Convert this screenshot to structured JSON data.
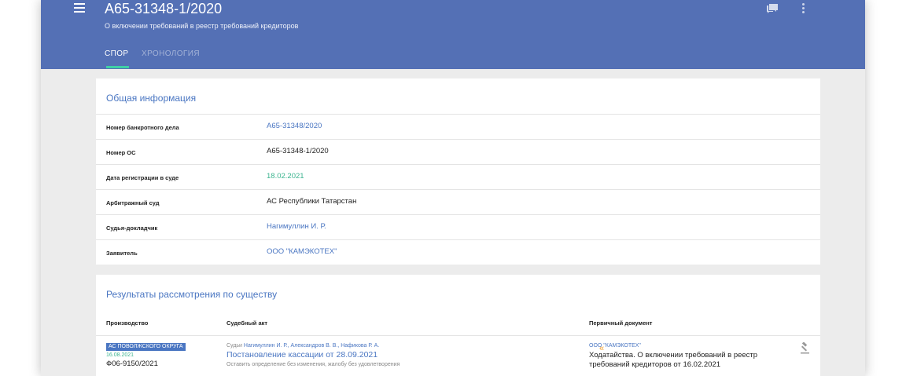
{
  "header": {
    "title": "А65-31348-1/2020",
    "subtitle": "О включении требований в реестр требований кредиторов",
    "tabs": [
      {
        "label": "СПОР",
        "active": true
      },
      {
        "label": "ХРОНОЛОГИЯ",
        "active": false
      }
    ],
    "icons": {
      "menu": "menu-icon",
      "chat": "chat-icon",
      "more": "more-vert-icon"
    }
  },
  "general": {
    "title": "Общая информация",
    "rows": [
      {
        "label": "Номер банкротного дела",
        "value": "А65-31348/2020"
      },
      {
        "label": "Номер ОС",
        "value": "А65-31348-1/2020"
      },
      {
        "label": "Дата регистрации в суде",
        "value": "18.02.2021"
      },
      {
        "label": "Арбитражный суд",
        "value": "АС Республики Татарстан"
      },
      {
        "label": "Судья-докладчик",
        "value": "Нагимуллин И. Р."
      },
      {
        "label": "Заявитель",
        "value": "ООО \"КАМЭКОТЕХ\""
      }
    ]
  },
  "results": {
    "title": "Результаты рассмотрения по существу",
    "columns": [
      "Производство",
      "Судебный акт",
      "Первичный документ"
    ],
    "row": {
      "court_badge": "АС ПОВОЛЖСКОГО ОКРУГА",
      "date": "16.08.2021",
      "case_number": "Ф06-9150/2021",
      "judges_prefix": "Судьи",
      "judges": "Нагимуллин И. Р., Александров В. В., Нафикова Р. А.",
      "act_title": "Постановление кассации от 28.09.2021",
      "act_result": "Оставить определение без изменения, жалобу без удовлетворения",
      "primary_party": "ООО \"КАМЭКОТЕХ\"",
      "primary_doc_line1": "Ходатайства. О включении требований в реестр",
      "primary_doc_line2": "требований кредиторов от 16.02.2021"
    }
  },
  "colors": {
    "header_bg": "#5470b5",
    "accent": "#4a76c2",
    "green": "#3cb48f",
    "tab_indicator": "#3fd0a6",
    "chevron": "#f0a030"
  }
}
